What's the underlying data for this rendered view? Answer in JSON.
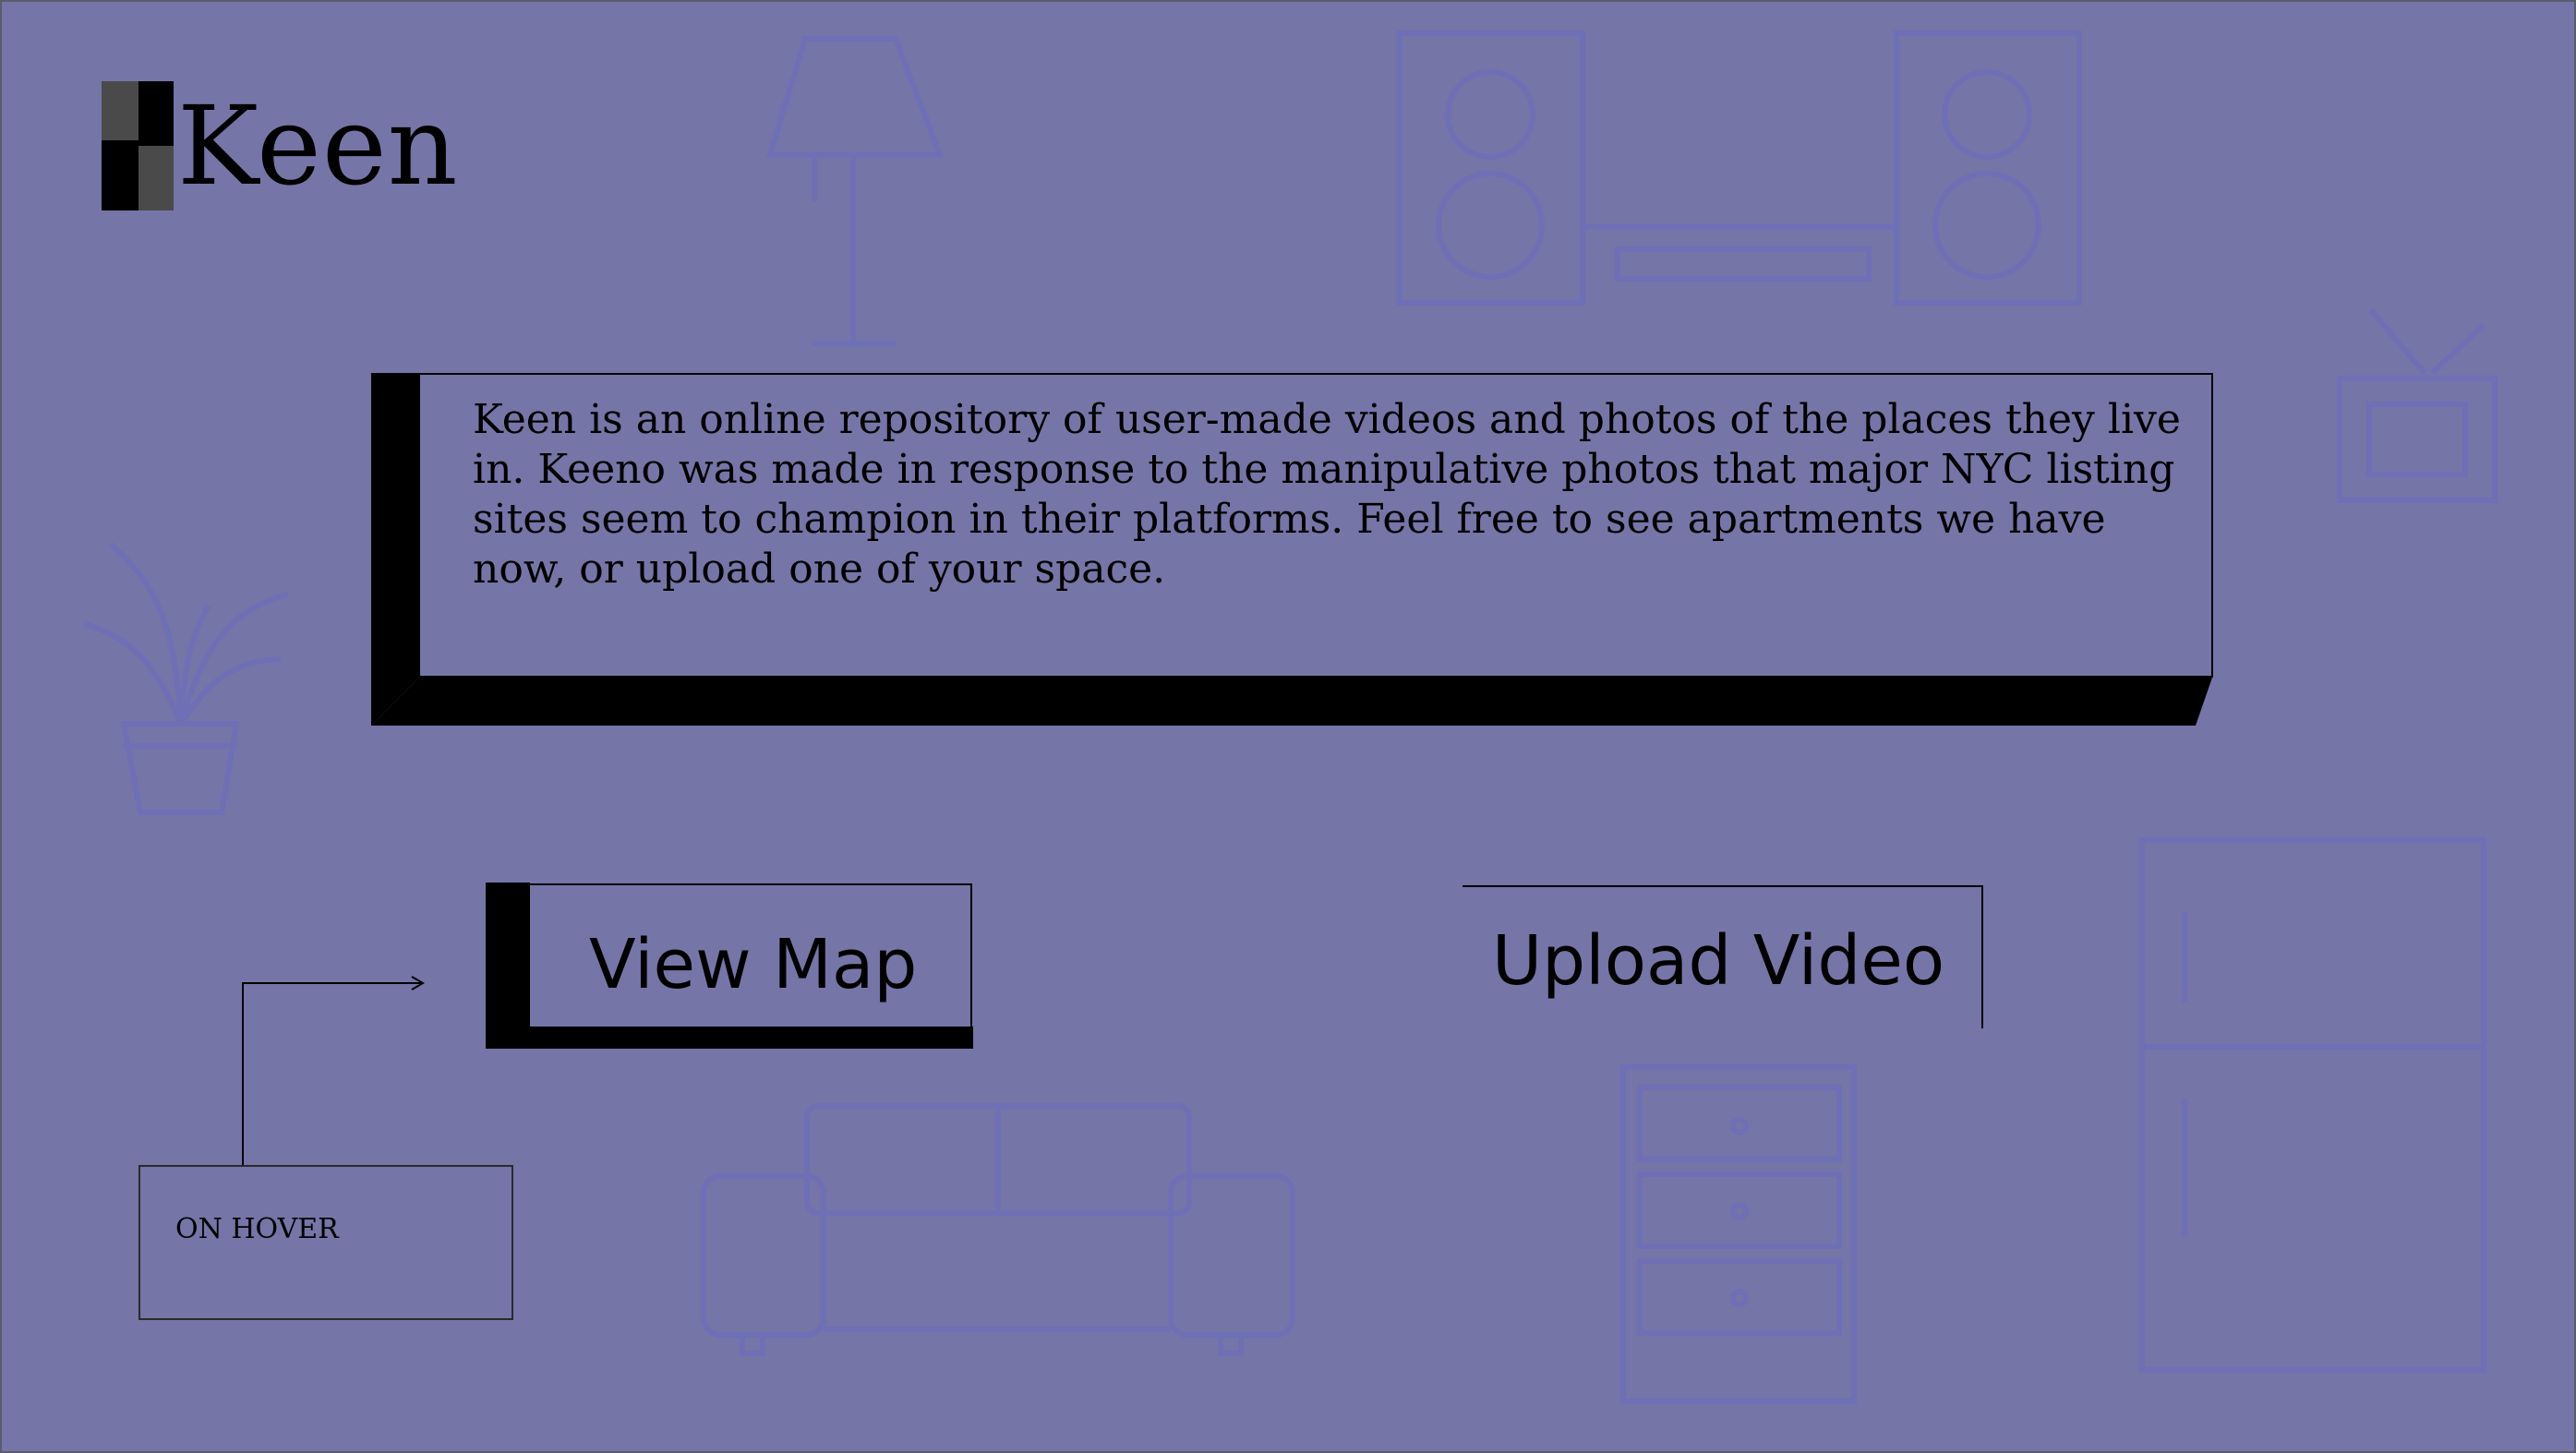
{
  "brand": {
    "name": "Keen"
  },
  "intro": {
    "text": "Keen is an online repository of user-made videos and photos of the places they live in. Keeno was made in response to the manipulative photos that major NYC listing sites seem to champion in their platforms. Feel free to see apartments we have now, or upload one of your space."
  },
  "actions": {
    "view_map_label": "View Map",
    "upload_video_label": "Upload Video"
  },
  "annotation": {
    "hover_label": "ON HOVER"
  },
  "colors": {
    "background": "#7575a8",
    "illustration_stroke": "#6f6fb6",
    "ink": "#000000",
    "logo_gray": "#4a4a4a"
  },
  "background_illustrations": [
    "floor-lamp-icon",
    "stereo-speakers-icon",
    "tv-icon",
    "plant-icon",
    "sofa-icon",
    "dresser-icon",
    "refrigerator-icon"
  ]
}
